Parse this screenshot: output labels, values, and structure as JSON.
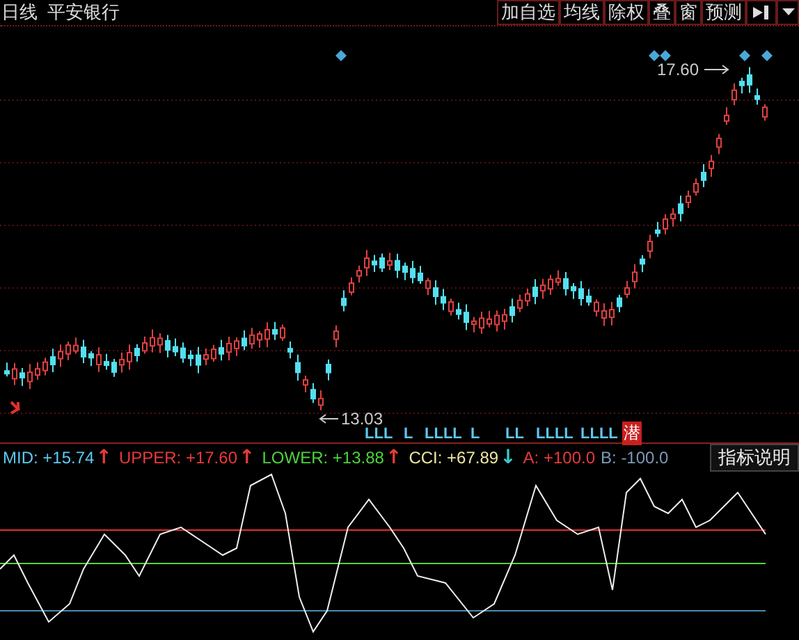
{
  "toolbar": {
    "period": "日线",
    "stock": "平安银行",
    "buttons": [
      {
        "label": "加自选"
      },
      {
        "label": "均线"
      },
      {
        "label": "除权"
      },
      {
        "label": "叠"
      },
      {
        "label": "窗"
      },
      {
        "label": "预测"
      }
    ]
  },
  "price_chart": {
    "high_label": "17.60",
    "low_label": "13.03",
    "signal_marks": [
      "LLL",
      "L",
      "LLLL",
      "L",
      "LL",
      "LLLL",
      "LLLL"
    ],
    "signal_tag": "潜"
  },
  "indicator": {
    "legend": [
      {
        "label": "MID: +15.74",
        "color": "#5ec8f0",
        "arrow": {
          "symbol": "↑",
          "color": "#e83a3a"
        }
      },
      {
        "label": "UPPER: +17.60",
        "color": "#e83a3a",
        "arrow": {
          "symbol": "↑",
          "color": "#e83a3a"
        }
      },
      {
        "label": "LOWER: +13.88",
        "color": "#4cd23c",
        "arrow": {
          "symbol": "↑",
          "color": "#e83a3a"
        }
      },
      {
        "label": "CCI: +67.89",
        "color": "#f0e6a0",
        "arrow": {
          "symbol": "↓",
          "color": "#3cc8c8"
        }
      },
      {
        "label": "A: +100.0",
        "color": "#e83a3a"
      },
      {
        "label": "B: -100.0",
        "color": "#7a9ab8"
      }
    ],
    "help_button": "指标说明"
  }
}
